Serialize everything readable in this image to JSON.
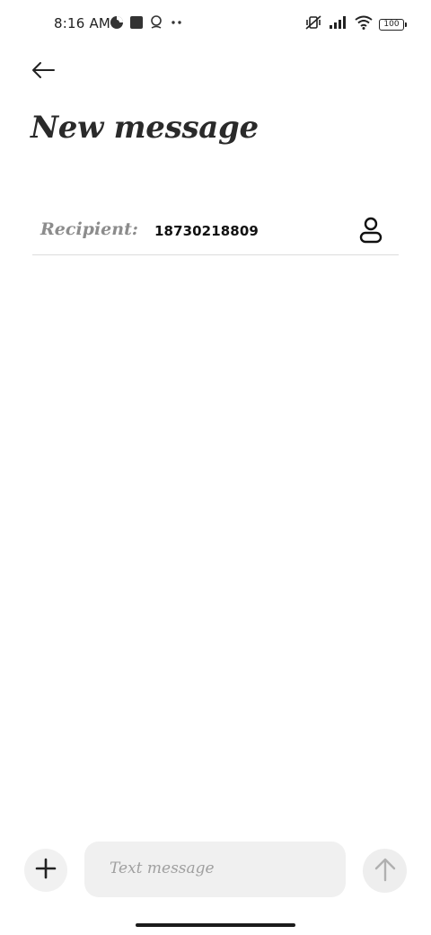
{
  "status_bar": {
    "time": "8:16 AM",
    "left_icons": [
      "data-saver-icon",
      "square-app-icon",
      "location-pin-icon",
      "more-dots-icon"
    ],
    "right_icons": [
      "vibrate-off-icon",
      "signal-icon",
      "wifi-icon",
      "battery-icon"
    ],
    "battery_level": "100"
  },
  "header": {
    "back_icon": "arrow-left-icon",
    "title": "New message"
  },
  "recipient": {
    "label": "Recipient:",
    "value": "18730218809",
    "contact_icon": "person-icon"
  },
  "composer": {
    "add_icon": "plus-icon",
    "placeholder": "Text message",
    "send_icon": "arrow-up-icon"
  }
}
